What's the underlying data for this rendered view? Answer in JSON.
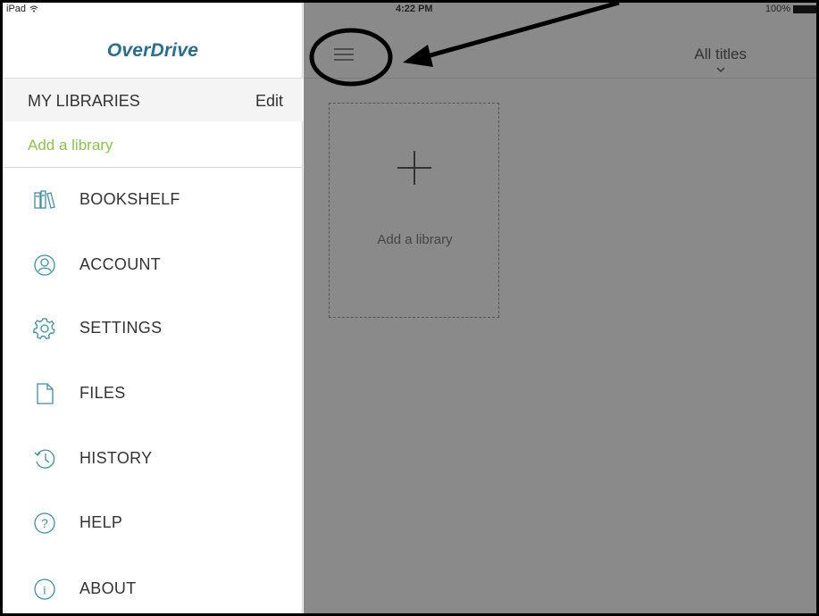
{
  "status_bar": {
    "device": "iPad",
    "time": "4:22 PM",
    "battery": "100%"
  },
  "sidebar": {
    "brand": "OverDrive",
    "libraries_title": "MY LIBRARIES",
    "edit_label": "Edit",
    "add_library_link": "Add a library",
    "items": [
      {
        "label": "BOOKSHELF",
        "icon": "bookshelf-icon"
      },
      {
        "label": "ACCOUNT",
        "icon": "account-icon"
      },
      {
        "label": "SETTINGS",
        "icon": "settings-gear-icon"
      },
      {
        "label": "FILES",
        "icon": "file-icon"
      },
      {
        "label": "HISTORY",
        "icon": "history-icon"
      },
      {
        "label": "HELP",
        "icon": "help-icon"
      },
      {
        "label": "ABOUT",
        "icon": "info-icon"
      }
    ]
  },
  "main": {
    "filter_label": "All titles",
    "add_card_label": "Add a library"
  },
  "colors": {
    "brand": "#2a6e8e",
    "accent_green": "#8bc34a",
    "icon_teal": "#3f8fa6",
    "overlay_gray": "#8a8a8a"
  }
}
